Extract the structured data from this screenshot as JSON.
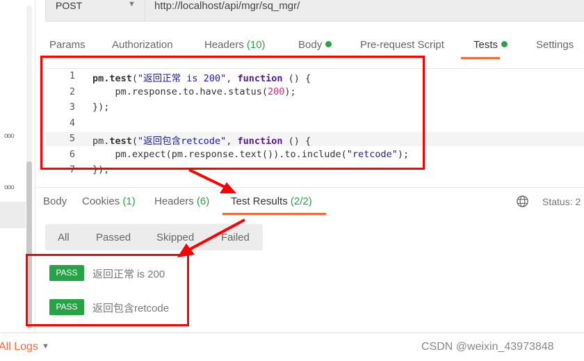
{
  "request": {
    "method": "POST",
    "url": "http://localhost/api/mgr/sq_mgr/"
  },
  "request_tabs": [
    {
      "label": "Params"
    },
    {
      "label": "Authorization"
    },
    {
      "label": "Headers",
      "count": "(10)"
    },
    {
      "label": "Body",
      "dot": true
    },
    {
      "label": "Pre-request Script"
    },
    {
      "label": "Tests",
      "dot": true,
      "active": true
    },
    {
      "label": "Settings"
    }
  ],
  "editor": {
    "line_numbers": [
      "1",
      "2",
      "3",
      "4",
      "5",
      "6",
      "7"
    ],
    "lines": [
      [
        [
          "fn",
          "pm."
        ],
        [
          "fn",
          "test"
        ],
        [
          "",
          "("
        ],
        [
          "str",
          "\"返回正常 is 200\""
        ],
        [
          "",
          ", "
        ],
        [
          "kw",
          "function"
        ],
        [
          "",
          " () {"
        ]
      ],
      [
        [
          "",
          "    pm.response.to.have.status("
        ],
        [
          "num",
          "200"
        ],
        [
          "",
          ");"
        ]
      ],
      [
        [
          "",
          "});"
        ]
      ],
      [],
      [
        [
          "",
          "pm."
        ],
        [
          "fn",
          "test"
        ],
        [
          "",
          "("
        ],
        [
          "str",
          "\"返回包含retcode\""
        ],
        [
          "",
          ", "
        ],
        [
          "kw",
          "function"
        ],
        [
          "",
          " () {"
        ]
      ],
      [
        [
          "",
          "    pm.expect(pm.response.text()).to.include("
        ],
        [
          "str",
          "\"retcode\""
        ],
        [
          "",
          ");"
        ]
      ],
      [
        [
          "",
          "});"
        ]
      ]
    ]
  },
  "response_tabs": [
    {
      "label": "Body"
    },
    {
      "label": "Cookies",
      "count": "(1)"
    },
    {
      "label": "Headers",
      "count": "(6)"
    },
    {
      "label": "Test Results",
      "count": "(2/2)",
      "active": true
    }
  ],
  "status": "Status: 2",
  "filters": [
    "All",
    "Passed",
    "Skipped",
    "Failed"
  ],
  "results": [
    {
      "badge": "PASS",
      "name": "返回正常 is 200"
    },
    {
      "badge": "PASS",
      "name": "返回包含retcode"
    }
  ],
  "footer": {
    "logs": "All Logs",
    "watermark": "CSDN @weixin_43973848"
  },
  "colors": {
    "accent": "#f26b3a",
    "pass": "#26a345",
    "annotation": "#ff0000"
  }
}
